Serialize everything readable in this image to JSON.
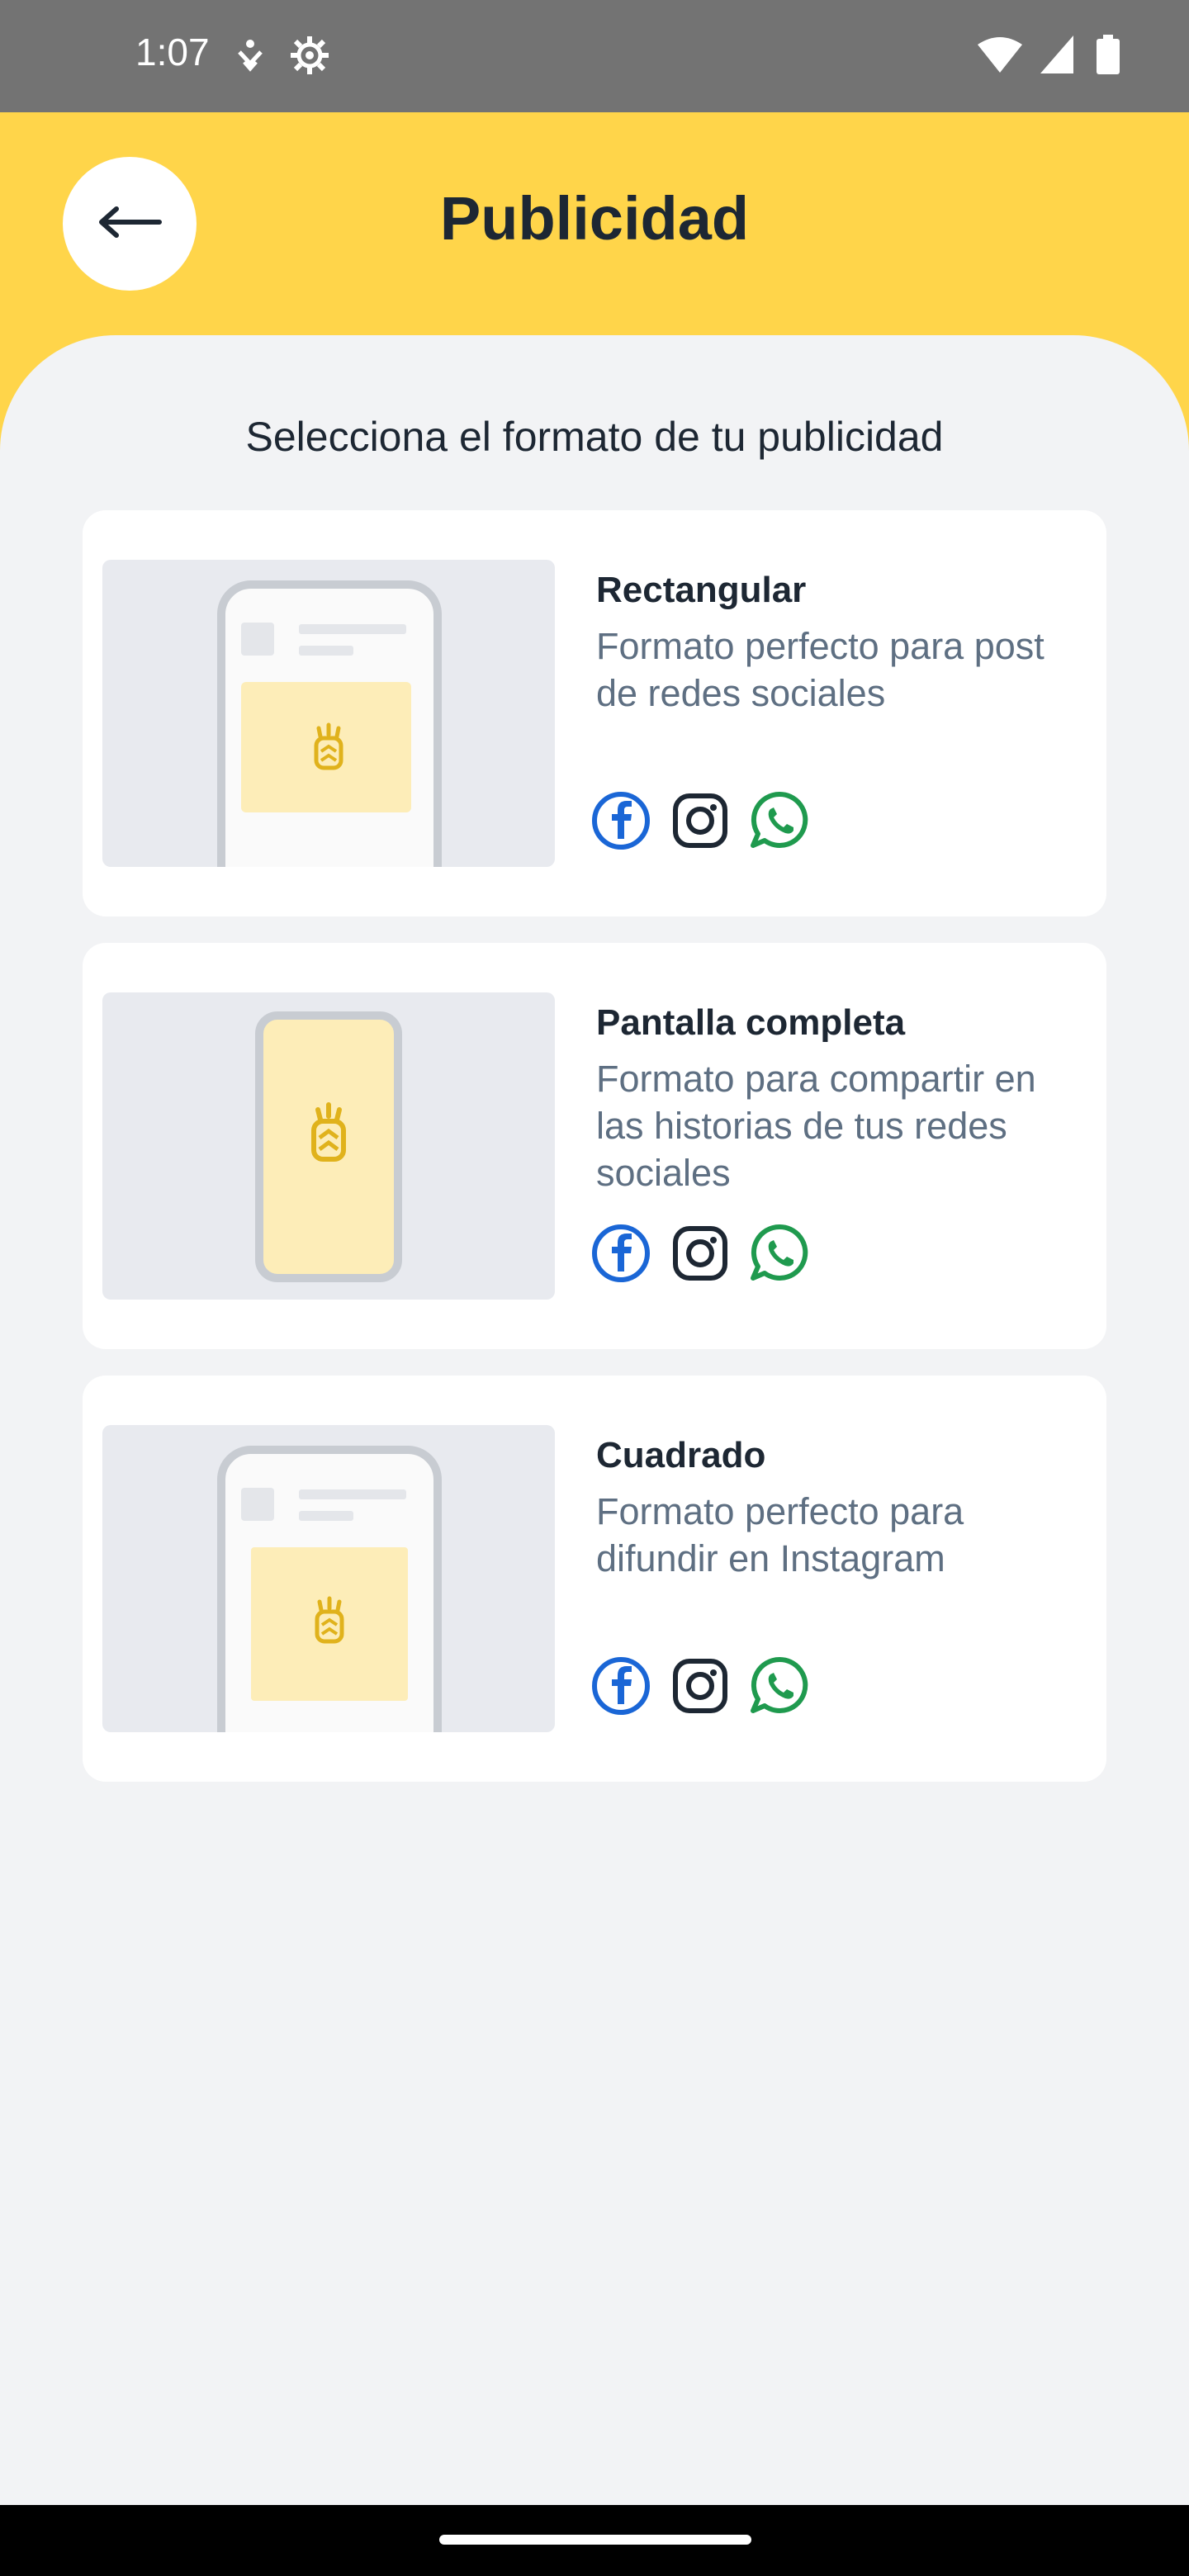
{
  "status_bar": {
    "time": "1:07",
    "left_icons": [
      "accessibility-icon",
      "settings-icon"
    ],
    "right_icons": [
      "wifi-icon",
      "signal-icon",
      "battery-icon"
    ]
  },
  "header": {
    "title": "Publicidad",
    "back_icon": "arrow-left-icon",
    "background_color": "#ffd54a"
  },
  "main": {
    "subtitle": "Selecciona el formato de tu publicidad",
    "formats": [
      {
        "title": "Rectangular",
        "description": "Formato perfecto para post de redes sociales",
        "preview": "rectangular-preview",
        "networks": [
          "facebook-icon",
          "instagram-icon",
          "whatsapp-icon"
        ]
      },
      {
        "title": "Pantalla completa",
        "description": "Formato para compartir en las historias de tus redes sociales",
        "preview": "fullscreen-preview",
        "networks": [
          "facebook-icon",
          "instagram-icon",
          "whatsapp-icon"
        ]
      },
      {
        "title": "Cuadrado",
        "description": "Formato perfecto para difundir en Instagram",
        "preview": "square-preview",
        "networks": [
          "facebook-icon",
          "instagram-icon",
          "whatsapp-icon"
        ]
      }
    ]
  },
  "colors": {
    "accent_yellow": "#ffd54a",
    "ad_yellow": "#fdedb8",
    "pineapple_gold": "#e0b21c",
    "facebook_blue": "#1a66d6",
    "whatsapp_green": "#1f9a4e",
    "title_dark": "#1d2733",
    "desc_gray": "#5e6f82"
  }
}
